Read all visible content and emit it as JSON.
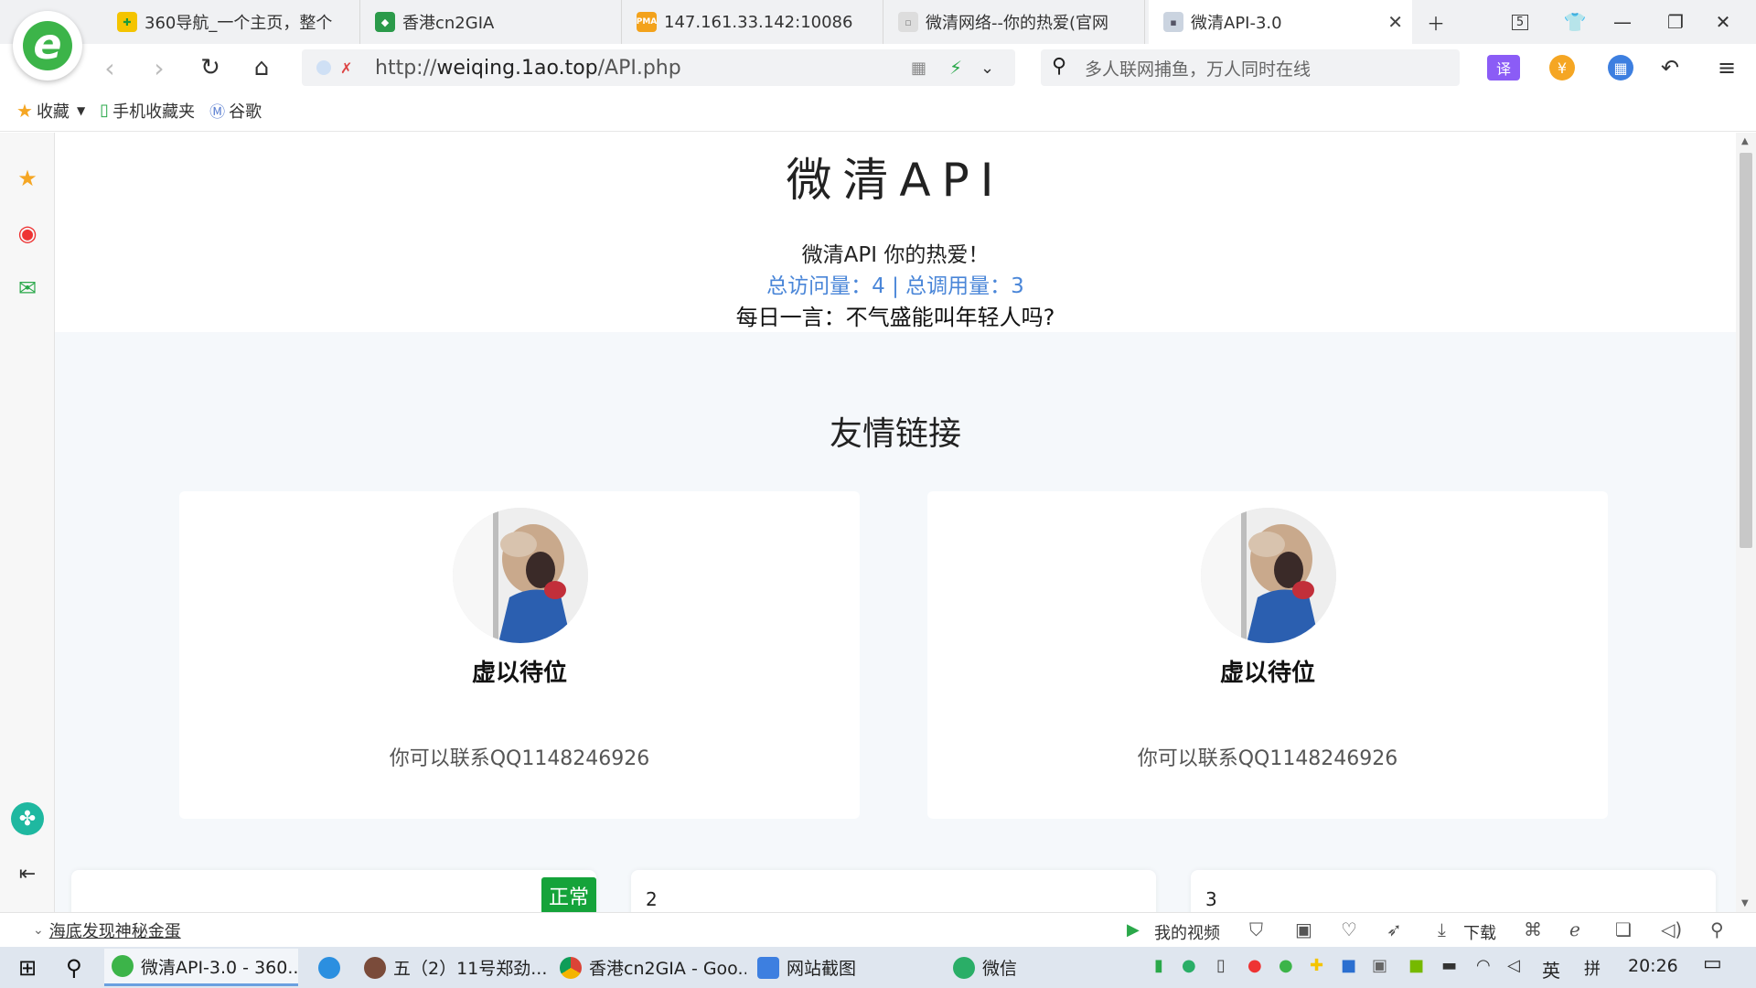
{
  "browser": {
    "tabs": [
      {
        "label": "360导航_一个主页，整个"
      },
      {
        "label": "香港cn2GIA"
      },
      {
        "label": "147.161.33.142:10086"
      },
      {
        "label": "微清网络--你的热爱(官网"
      },
      {
        "label": "微清API-3.0",
        "active": true
      }
    ],
    "tab_count": "5",
    "url_prefix": "http://",
    "url_host": "weiqing.1ao.top",
    "url_path": "/API.php",
    "search_placeholder": "多人联网捕鱼，万人同时在线",
    "bookmarks": [
      {
        "label": "收藏"
      },
      {
        "label": "手机收藏夹"
      },
      {
        "label": "谷歌"
      }
    ]
  },
  "page": {
    "title": "微清API",
    "tagline": "微清API 你的热爱！",
    "stats": "总访问量：4 | 总调用量：3",
    "daily_quote": "每日一言：不气盛能叫年轻人吗?",
    "section_title": "友情链接",
    "cards": [
      {
        "name": "虚以待位",
        "contact": "你可以联系QQ1148246926"
      },
      {
        "name": "虚以待位",
        "contact": "你可以联系QQ1148246926"
      }
    ],
    "boxes": [
      {
        "num": "",
        "badge": "正常"
      },
      {
        "num": "2"
      },
      {
        "num": "3"
      }
    ]
  },
  "statusbar": {
    "left_text": "海底发现神秘金蛋",
    "my_video": "我的视频",
    "download": "下载"
  },
  "taskbar": {
    "items": [
      {
        "label": "微清API-3.0 - 360..."
      },
      {
        "label": "五（2）11号郑劲..."
      },
      {
        "label": "香港cn2GIA - Goo..."
      },
      {
        "label": "网站截图"
      },
      {
        "label": "微信"
      }
    ],
    "ime_lang": "英",
    "ime_mode": "拼",
    "time": "20:26"
  },
  "colors": {
    "accent_green": "#3cb449",
    "link_blue": "#4a86d8",
    "badge_green": "#15a33a"
  }
}
